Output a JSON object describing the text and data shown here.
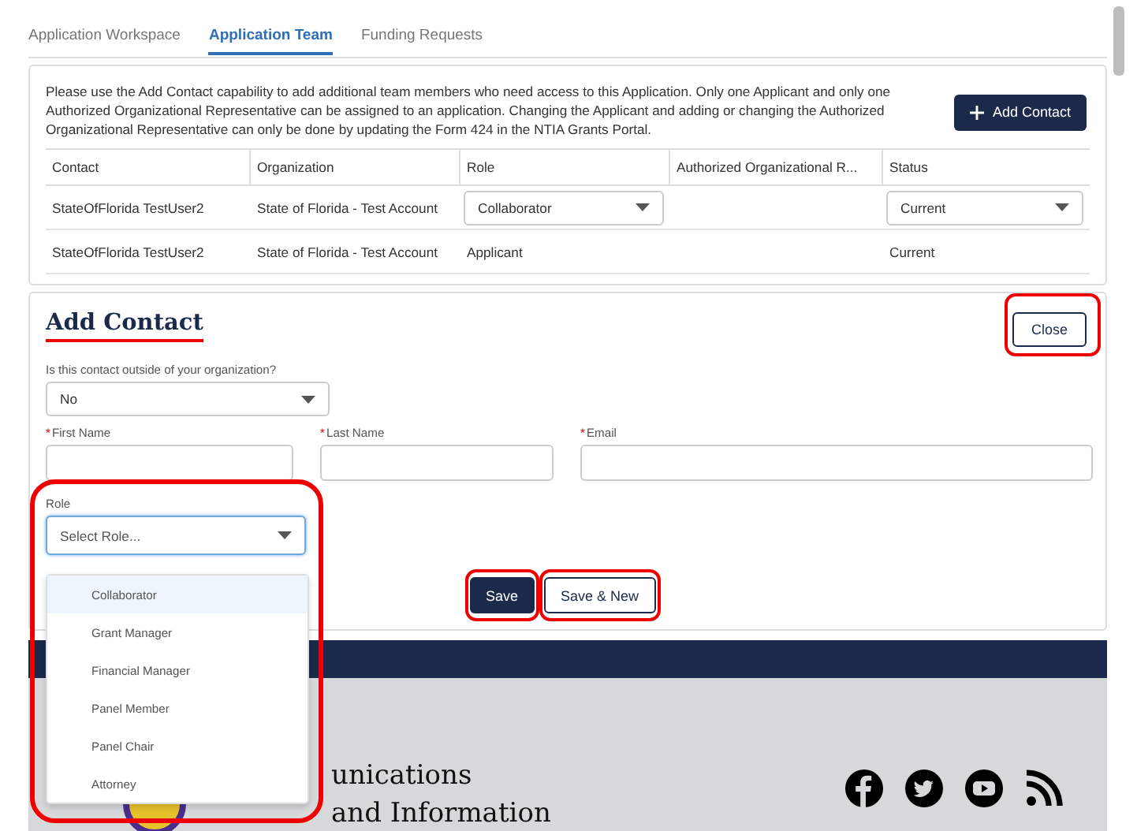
{
  "tabs": [
    {
      "label": "Application Workspace",
      "selected": false
    },
    {
      "label": "Application Team",
      "selected": true
    },
    {
      "label": "Funding Requests",
      "selected": false
    }
  ],
  "team_panel": {
    "notice": "Please use the Add Contact capability to add additional team members who need access to this Application. Only one Applicant and only one Authorized Organizational Representative can be assigned to an application. Changing the Applicant and adding or changing the Authorized Organizational Representative can only be done by updating the Form 424 in the NTIA Grants Portal.",
    "add_button": "Add Contact",
    "columns": [
      "Contact",
      "Organization",
      "Role",
      "Authorized Organizational R...",
      "Status"
    ],
    "rows": [
      {
        "cells": [
          {
            "kind": "text",
            "value": "StateOfFlorida TestUser2"
          },
          {
            "kind": "text",
            "value": "State of Florida - Test Account"
          },
          {
            "kind": "select",
            "value": "Collaborator"
          },
          {
            "kind": "blank"
          },
          {
            "kind": "select",
            "value": "Current"
          }
        ]
      },
      {
        "cells": [
          {
            "kind": "text",
            "value": "StateOfFlorida TestUser2"
          },
          {
            "kind": "text",
            "value": "State of Florida - Test Account"
          },
          {
            "kind": "text",
            "value": "Applicant"
          },
          {
            "kind": "blank"
          },
          {
            "kind": "text",
            "value": "Current"
          }
        ]
      }
    ]
  },
  "add_contact": {
    "title": "Add Contact",
    "close_button": "Close",
    "question": "Is this contact outside of your organization?",
    "question_value": "No",
    "required_mark": "*",
    "fields": [
      {
        "label": "First Name",
        "required": true
      },
      {
        "label": "Last Name",
        "required": true
      },
      {
        "label": "Email",
        "required": true
      }
    ],
    "role": {
      "label": "Role",
      "placeholder": "Select Role...",
      "expanded": true,
      "options": [
        {
          "label": "Collaborator",
          "selected": true
        },
        {
          "label": "Grant Manager",
          "selected": false
        },
        {
          "label": "Financial Manager",
          "selected": false
        },
        {
          "label": "Panel Member",
          "selected": false
        },
        {
          "label": "Panel Chair",
          "selected": false
        },
        {
          "label": "Attorney",
          "selected": false
        }
      ]
    },
    "buttons": [
      {
        "label": "Save",
        "kind": "primary"
      },
      {
        "label": "Save & New",
        "kind": "secondary"
      }
    ]
  },
  "footer": {
    "title_lines": [
      "unications",
      "and Information"
    ]
  }
}
